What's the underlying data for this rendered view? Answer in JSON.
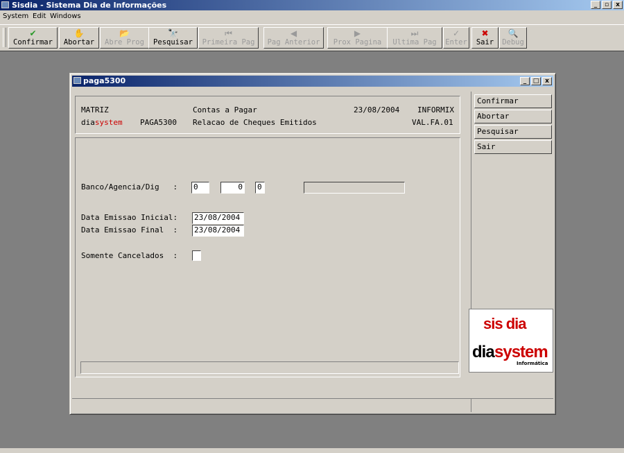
{
  "app": {
    "title": "Sisdia - Sistema Dia de Informações",
    "win_min": "_",
    "win_max": "▫",
    "win_close": "x"
  },
  "menu": [
    "System",
    "Edit",
    "Windows"
  ],
  "toolbar": [
    {
      "label": "Confirmar",
      "icon": "✔",
      "enabled": true,
      "icon_name": "check-icon"
    },
    {
      "label": "Abortar",
      "icon": "✋",
      "enabled": true,
      "icon_name": "hand-icon"
    },
    {
      "label": "Abre Prog",
      "icon": "📂",
      "enabled": false,
      "icon_name": "folder-open-icon"
    },
    {
      "label": "Pesquisar",
      "icon": "🔭",
      "enabled": true,
      "icon_name": "binoculars-icon"
    },
    {
      "label": "Primeira Pag",
      "icon": "⏮",
      "enabled": false,
      "icon_name": "first-page-icon"
    },
    {
      "label": "Pag Anterior",
      "icon": "◀",
      "enabled": false,
      "icon_name": "prev-page-icon"
    },
    {
      "label": "Prox Pagina",
      "icon": "▶",
      "enabled": false,
      "icon_name": "next-page-icon"
    },
    {
      "label": "Ultima Pag",
      "icon": "⏭",
      "enabled": false,
      "icon_name": "last-page-icon"
    },
    {
      "label": "Enter",
      "icon": "✓",
      "enabled": false,
      "icon_name": "enter-icon"
    },
    {
      "label": "Sair",
      "icon": "✖",
      "enabled": true,
      "icon_name": "exit-icon"
    },
    {
      "label": "Debug",
      "icon": "🔍",
      "enabled": false,
      "icon_name": "magnifier-icon"
    }
  ],
  "child": {
    "title": "paga5300",
    "win_min": "_",
    "win_max": "□",
    "win_close": "x"
  },
  "header": {
    "company": "MATRIZ",
    "module": "Contas a Pagar",
    "date": "23/08/2004",
    "db": "INFORMIX",
    "brand_prefix": "dia",
    "brand_suffix": "system",
    "program": "PAGA5300",
    "report": "Relacao de Cheques Emitidos",
    "version": "VAL.FA.01"
  },
  "form": {
    "banco_label": "Banco/Agencia/Dig   :",
    "banco_value": "0",
    "agencia_value": "0",
    "dig_value": "0",
    "banco_desc": "",
    "data_inicial_label": "Data Emissao Inicial:",
    "data_inicial_value": "23/08/2004",
    "data_final_label": "Data Emissao Final  :",
    "data_final_value": "23/08/2004",
    "cancelados_label": "Somente Cancelados  :",
    "cancelados_checked": false,
    "status_text": ""
  },
  "side_buttons": [
    "Confirmar",
    "Abortar",
    "Pesquisar",
    "Sair"
  ],
  "logo": {
    "line1": "sis dia",
    "line2_black": "dia",
    "line2_red": "system",
    "line3": "Informática"
  }
}
